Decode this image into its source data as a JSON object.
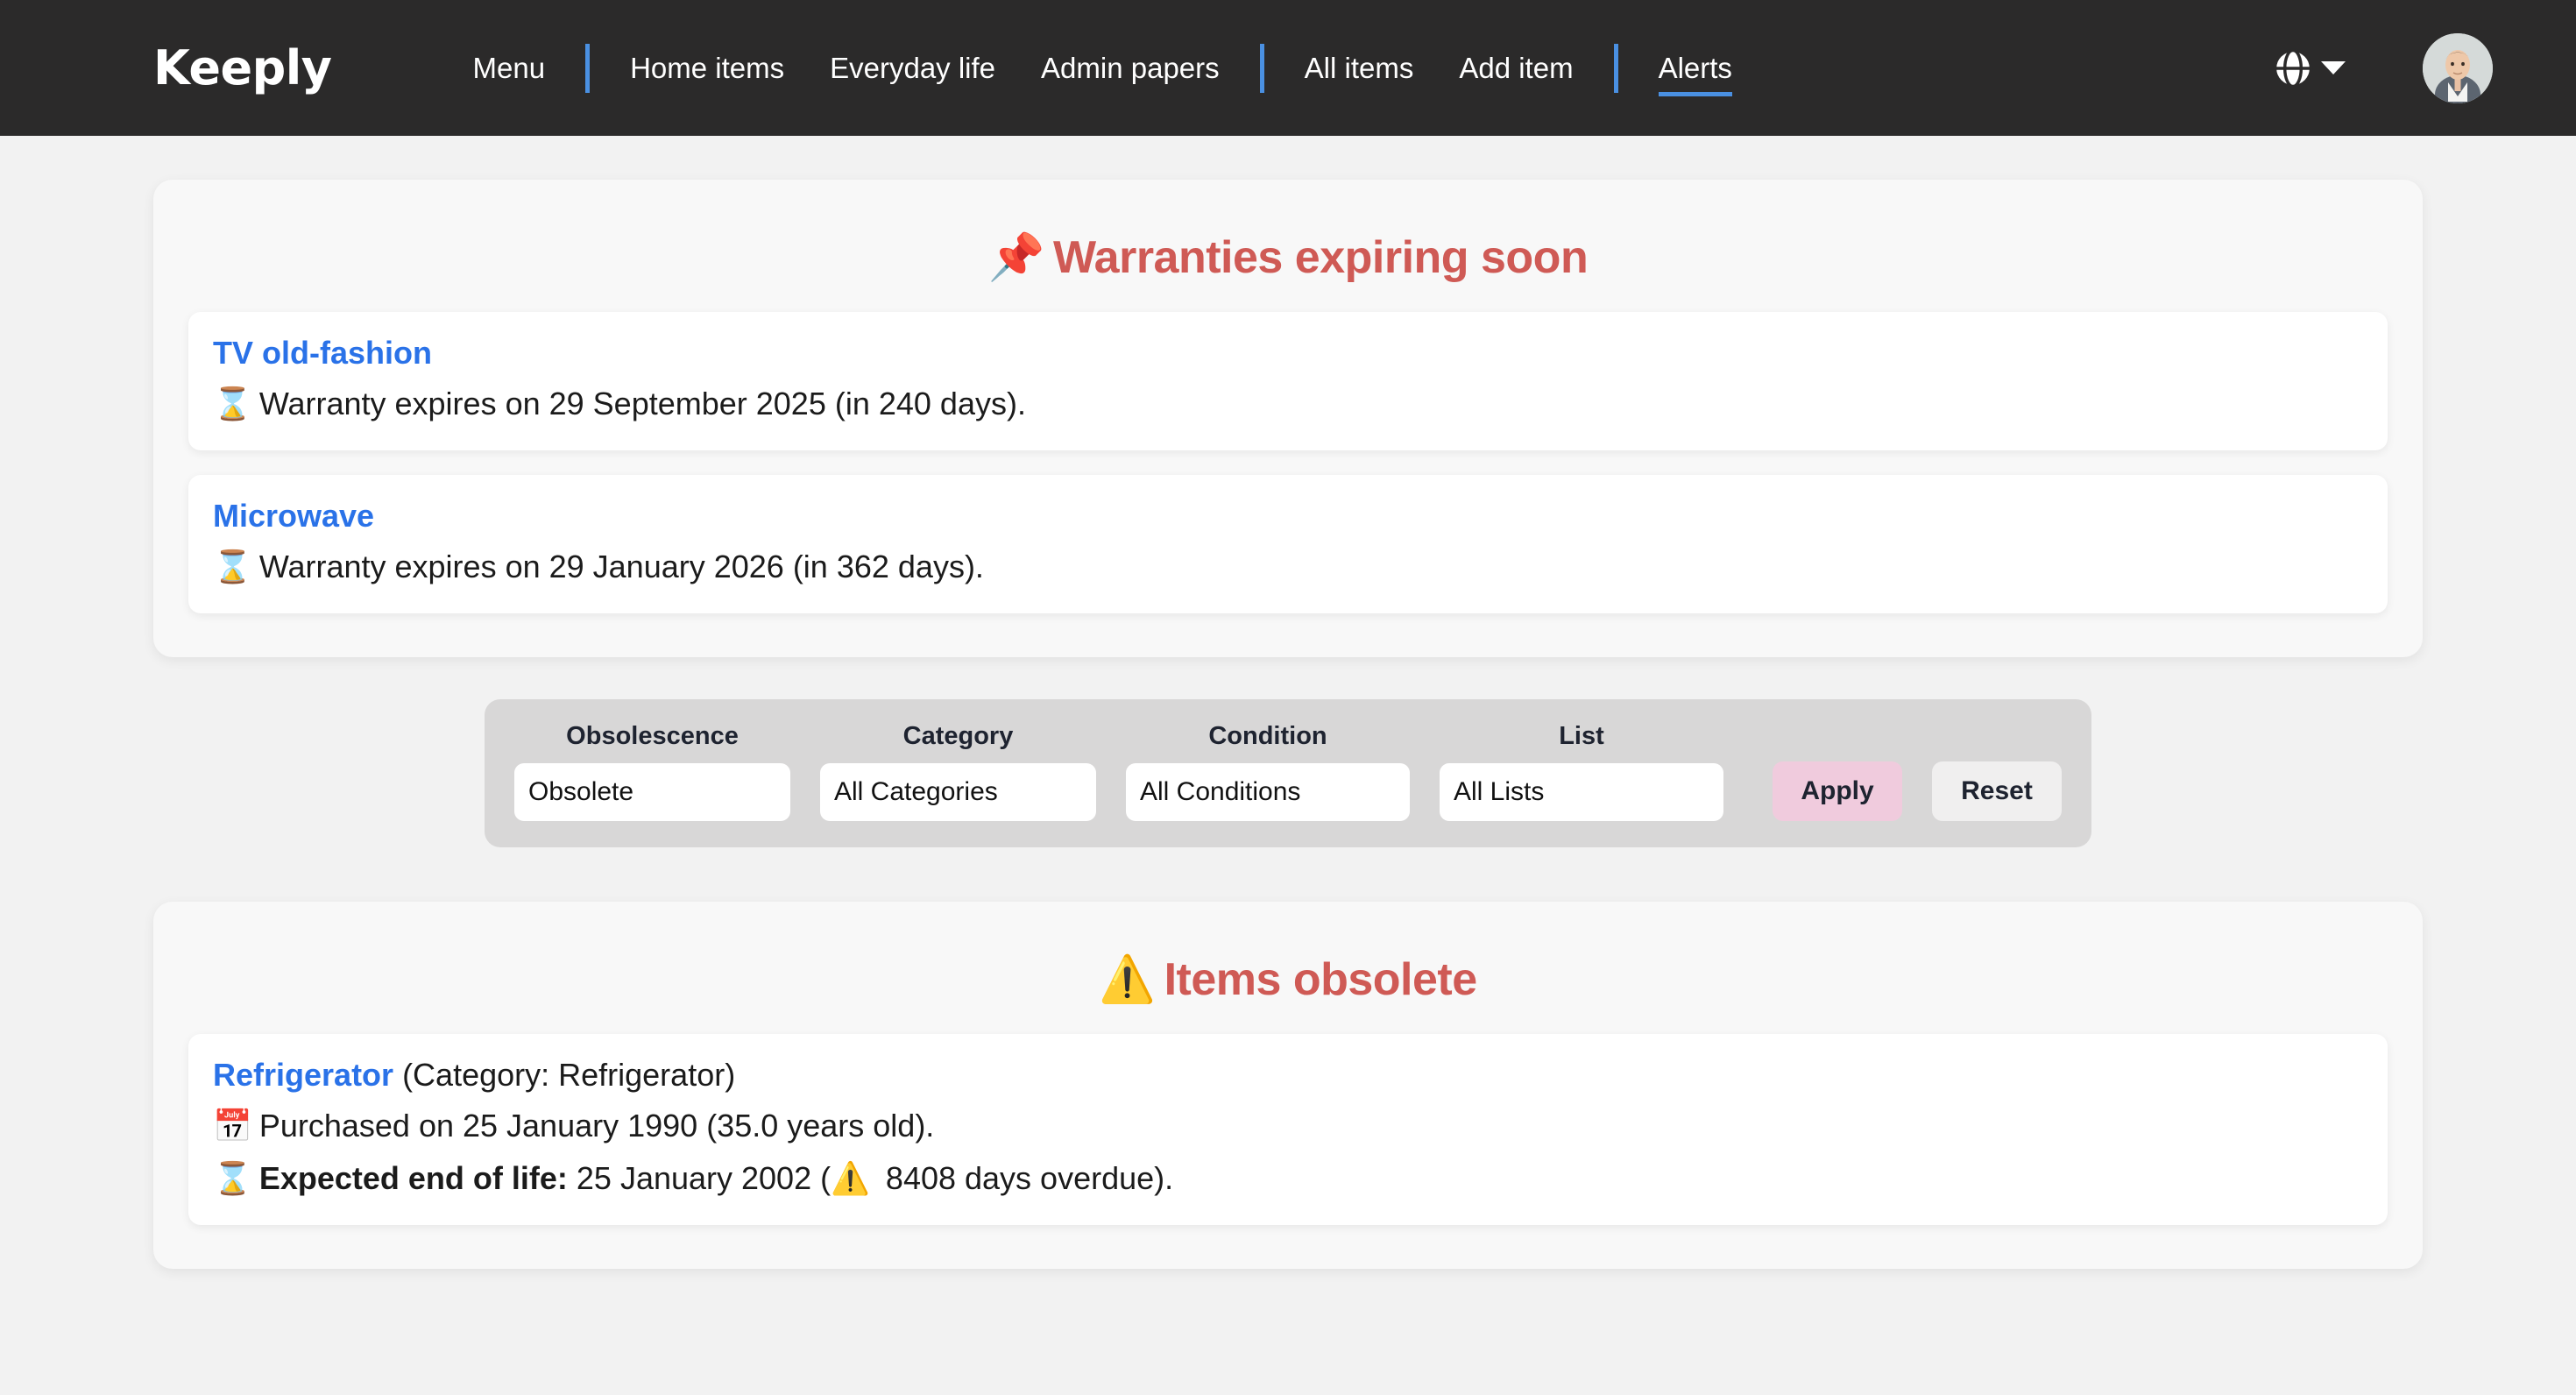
{
  "navbar": {
    "brand": "Keeply",
    "menu_label": "Menu",
    "group_one": [
      "Home items",
      "Everyday life",
      "Admin papers"
    ],
    "group_two": [
      "All items",
      "Add item"
    ],
    "active_link": "Alerts",
    "language_icon": "globe-icon",
    "caret_icon": "chevron-down-icon",
    "avatar_icon": "user-avatar"
  },
  "warranties": {
    "emoji": "📌",
    "title": "Warranties expiring soon",
    "items": [
      {
        "name": "TV old-fashion",
        "emoji": "⌛",
        "detail": "Warranty expires on 29 September 2025 (in 240 days)."
      },
      {
        "name": "Microwave",
        "emoji": "⌛",
        "detail": "Warranty expires on 29 January 2026 (in 362 days)."
      }
    ]
  },
  "filters": {
    "groups": [
      {
        "label": "Obsolescence",
        "value": "Obsolete"
      },
      {
        "label": "Category",
        "value": "All Categories"
      },
      {
        "label": "Condition",
        "value": "All Conditions"
      },
      {
        "label": "List",
        "value": "All Lists"
      }
    ],
    "apply_label": "Apply",
    "reset_label": "Reset",
    "apply_color": "#f0cbdd",
    "reset_color": "#f0efef"
  },
  "obsolete": {
    "emoji": "⚠️",
    "title": "Items obsolete",
    "items": [
      {
        "name": "Refrigerator",
        "category_text": " (Category: Refrigerator)",
        "purchase_emoji": "📅",
        "purchase_text": "Purchased on 25 January 1990 (35.0 years old).",
        "eol_emoji": "⌛",
        "eol_label": "Expected end of life:",
        "eol_value": " 25 January 2002 (",
        "eol_warn_emoji": "⚠️",
        "eol_overdue": " 8408 days overdue)."
      }
    ]
  },
  "colors": {
    "navbar_bg": "#2b2a2a",
    "page_bg": "#f2f2f2",
    "accent_blue": "#4a90e2",
    "link_blue": "#2a72e8",
    "title_red": "#cf5a55",
    "filter_bar_bg": "#d8d7d7"
  }
}
